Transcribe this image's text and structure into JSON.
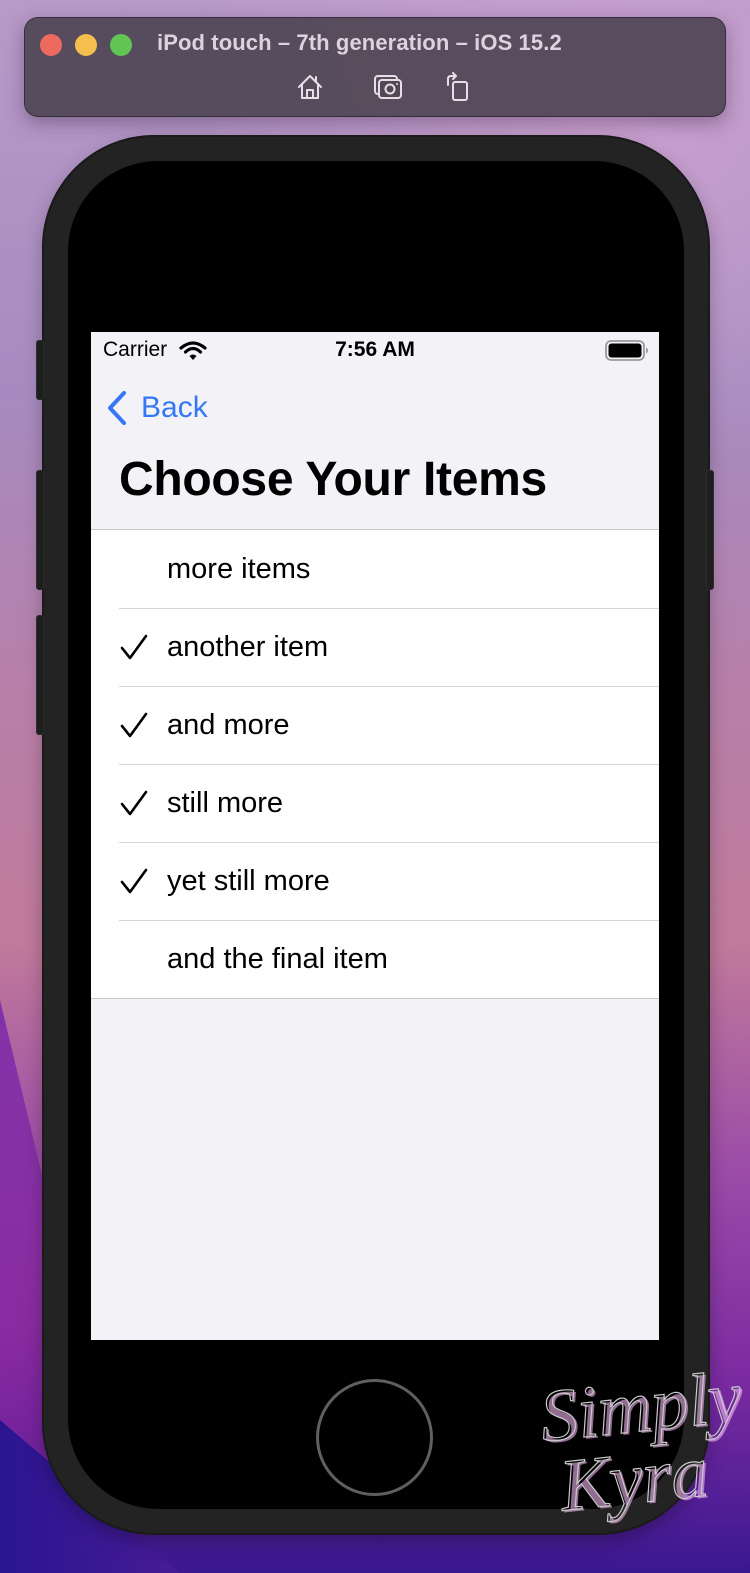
{
  "simulator": {
    "title": "iPod touch – 7th generation – iOS 15.2",
    "toolbar": [
      {
        "icon": "home-icon",
        "label": "Home"
      },
      {
        "icon": "screenshot-icon",
        "label": "Screenshot"
      },
      {
        "icon": "rotate-icon",
        "label": "Rotate"
      }
    ]
  },
  "status_bar": {
    "carrier": "Carrier",
    "time": "7:56 AM",
    "wifi_icon": "wifi-icon",
    "battery_icon": "battery-icon",
    "battery_level": 1.0
  },
  "nav": {
    "back_label": "Back",
    "title": "Choose Your Items"
  },
  "items": [
    {
      "label": "more items",
      "checked": false
    },
    {
      "label": "another item",
      "checked": true
    },
    {
      "label": "and more",
      "checked": true
    },
    {
      "label": "still more",
      "checked": true
    },
    {
      "label": "yet still more",
      "checked": true
    },
    {
      "label": "and the final item",
      "checked": false
    }
  ],
  "colors": {
    "accent": "#3478f6",
    "screen_background": "#f2f2f7",
    "row_background": "#ffffff"
  },
  "watermark": {
    "line1": "Simply",
    "line2": "Kyra"
  }
}
